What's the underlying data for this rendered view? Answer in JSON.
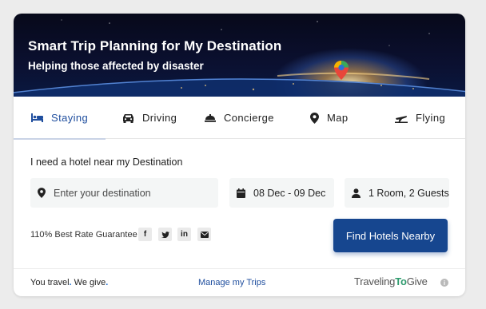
{
  "hero": {
    "title": "Smart Trip Planning for My Destination",
    "subtitle": "Helping those affected by disaster",
    "pin_icon": "map-pin-icon"
  },
  "tabs": [
    {
      "label": "Staying",
      "icon": "bed-icon",
      "active": true
    },
    {
      "label": "Driving",
      "icon": "car-icon",
      "active": false
    },
    {
      "label": "Concierge",
      "icon": "bell-icon",
      "active": false
    },
    {
      "label": "Map",
      "icon": "location-icon",
      "active": false
    },
    {
      "label": "Flying",
      "icon": "plane-icon",
      "active": false
    }
  ],
  "search": {
    "heading": "I need a hotel near my Destination",
    "destination_placeholder": "Enter your destination",
    "destination_value": "",
    "dates": "08 Dec - 09 Dec",
    "guests": "1 Room, 2 Guests"
  },
  "rate_text": "110% Best Rate Guarantee",
  "social": [
    {
      "name": "facebook-icon",
      "glyph": "f"
    },
    {
      "name": "twitter-icon",
      "glyph": "t"
    },
    {
      "name": "linkedin-icon",
      "glyph": "in"
    },
    {
      "name": "email-icon",
      "glyph": "✉"
    }
  ],
  "find_button": "Find Hotels Nearby",
  "footer": {
    "slogan_a": "You travel",
    "slogan_b": " We give",
    "dot": ".",
    "manage": "Manage my Trips",
    "brand_a": "Traveling",
    "brand_b": "To",
    "brand_c": "Give",
    "info": "i"
  },
  "colors": {
    "accent": "#16468f",
    "active_tab": "#1f4e9e",
    "brand_green": "#2f9b6e"
  }
}
